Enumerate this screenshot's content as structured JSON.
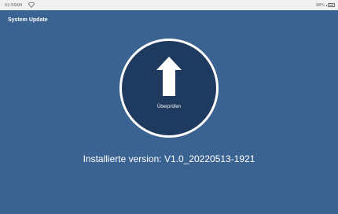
{
  "status_bar": {
    "time": "02:56AM",
    "battery": "98%",
    "battery_level": 0.98,
    "icons": [
      "wifi-icon",
      "battery-icon"
    ]
  },
  "header": {
    "title": "System Update"
  },
  "main": {
    "check_button_label": "Überprüfen",
    "check_button_icon": "arrow-up-icon",
    "version_label": "Installierte version:",
    "version_value": "V1.0_20220513-1921"
  },
  "colors": {
    "background": "#3b6391",
    "button_fill": "#1f3a5f",
    "button_ring": "#ffffff",
    "text": "#ffffff"
  }
}
